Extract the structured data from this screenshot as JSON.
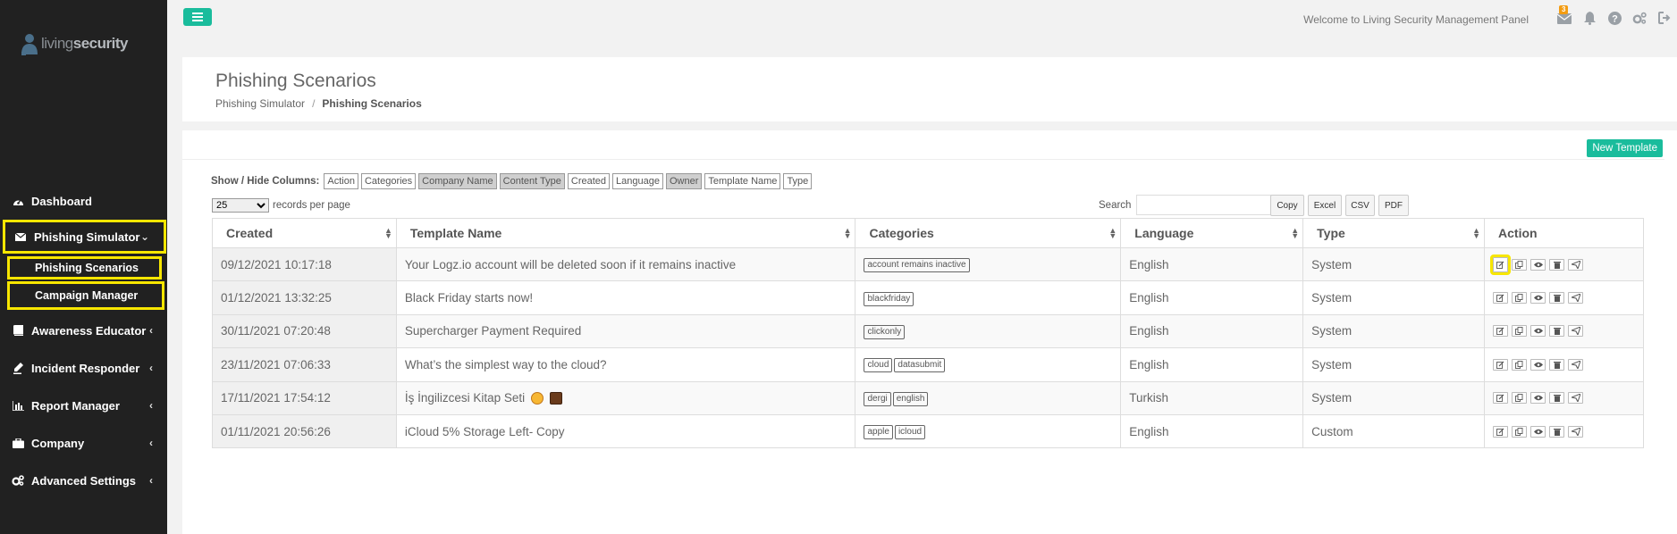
{
  "brand": {
    "name_light": "living",
    "name_bold": "security"
  },
  "sidebar": {
    "items": [
      {
        "label": "Dashboard",
        "icon": "dashboard-icon"
      },
      {
        "label": "Phishing Simulator",
        "icon": "envelope-icon",
        "expanded": true,
        "children": [
          {
            "label": "Phishing Scenarios"
          },
          {
            "label": "Campaign Manager"
          }
        ]
      },
      {
        "label": "Awareness Educator",
        "icon": "book-icon"
      },
      {
        "label": "Incident Responder",
        "icon": "pen-icon"
      },
      {
        "label": "Report Manager",
        "icon": "bar-chart-icon"
      },
      {
        "label": "Company",
        "icon": "briefcase-icon"
      },
      {
        "label": "Advanced Settings",
        "icon": "cogs-icon"
      }
    ]
  },
  "topbar": {
    "welcome": "Welcome to Living Security Management Panel",
    "mail_badge": "3"
  },
  "page": {
    "title": "Phishing Scenarios",
    "breadcrumb": {
      "parent": "Phishing Simulator",
      "sep": "/",
      "current": "Phishing Scenarios"
    }
  },
  "toolbar": {
    "new_template": "New Template",
    "colvis_label": "Show / Hide Columns:",
    "columns": [
      {
        "label": "Action",
        "hidden": false
      },
      {
        "label": "Categories",
        "hidden": false
      },
      {
        "label": "Company Name",
        "hidden": true
      },
      {
        "label": "Content Type",
        "hidden": true
      },
      {
        "label": "Created",
        "hidden": false
      },
      {
        "label": "Language",
        "hidden": false
      },
      {
        "label": "Owner",
        "hidden": true
      },
      {
        "label": "Template Name",
        "hidden": false
      },
      {
        "label": "Type",
        "hidden": false
      }
    ],
    "page_length": "25",
    "records_label": "records per page",
    "search_label": "Search",
    "search_value": "",
    "exports": [
      "Copy",
      "Excel",
      "CSV",
      "PDF"
    ]
  },
  "table": {
    "headers": [
      "Created",
      "Template Name",
      "Categories",
      "Language",
      "Type",
      "Action"
    ],
    "rows": [
      {
        "created": "09/12/2021 10:17:18",
        "name": "Your Logz.io account will be deleted soon if it remains inactive",
        "categories": [
          "account remains inactive"
        ],
        "language": "English",
        "type": "System"
      },
      {
        "created": "01/12/2021 13:32:25",
        "name": "Black Friday starts now!",
        "categories": [
          "blackfriday"
        ],
        "language": "English",
        "type": "System"
      },
      {
        "created": "30/11/2021 07:20:48",
        "name": "Supercharger Payment Required",
        "categories": [
          "clickonly"
        ],
        "language": "English",
        "type": "System"
      },
      {
        "created": "23/11/2021 07:06:33",
        "name": "What’s the simplest way to the cloud?",
        "categories": [
          "cloud",
          "datasubmit"
        ],
        "language": "English",
        "type": "System"
      },
      {
        "created": "17/11/2021 17:54:12",
        "name": "İş İngilizcesi Kitap Seti",
        "emoji": true,
        "categories": [
          "dergi",
          "english"
        ],
        "language": "Turkish",
        "type": "System"
      },
      {
        "created": "01/11/2021 20:56:26",
        "name": "iCloud 5% Storage Left- Copy",
        "categories": [
          "apple",
          "icloud"
        ],
        "language": "English",
        "type": "Custom"
      }
    ]
  },
  "colors": {
    "accent": "#1abc9c",
    "highlight": "#f7e600",
    "sidebar_bg": "#212121",
    "badge": "#f39c12"
  }
}
